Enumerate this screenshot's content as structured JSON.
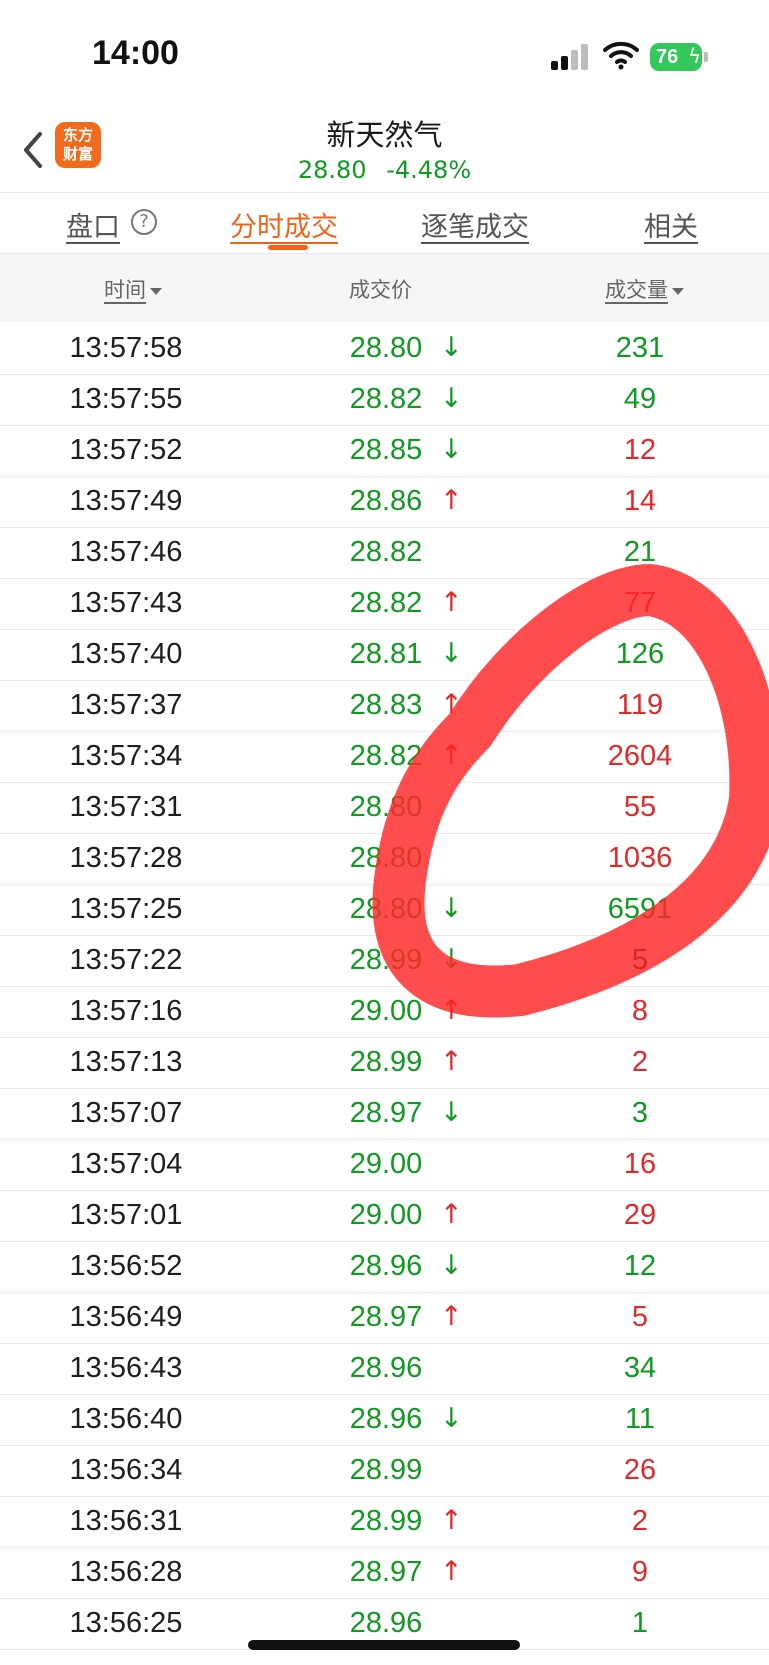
{
  "status": {
    "time": "14:00",
    "battery": "76"
  },
  "header": {
    "logo": "东方财富",
    "name": "新天然气",
    "price": "28.80",
    "change": "-4.48%"
  },
  "tabs": [
    {
      "label": "盘口"
    },
    {
      "label": "分时成交"
    },
    {
      "label": "逐笔成交"
    },
    {
      "label": "相关"
    }
  ],
  "columns": {
    "time": "时间",
    "price": "成交价",
    "volume": "成交量"
  },
  "colors": {
    "up": "#e02a2a",
    "down": "#119a22",
    "accent": "#f0631a"
  },
  "trades": [
    {
      "time": "13:57:58",
      "price": "28.80",
      "dir": "down",
      "arrow": "↓",
      "volume": "231",
      "vcolor": "g"
    },
    {
      "time": "13:57:55",
      "price": "28.82",
      "dir": "down",
      "arrow": "↓",
      "volume": "49",
      "vcolor": "g"
    },
    {
      "time": "13:57:52",
      "price": "28.85",
      "dir": "down",
      "arrow": "↓",
      "volume": "12",
      "vcolor": "r"
    },
    {
      "time": "13:57:49",
      "price": "28.86",
      "dir": "up",
      "arrow": "↑",
      "volume": "14",
      "vcolor": "r"
    },
    {
      "time": "13:57:46",
      "price": "28.82",
      "dir": "none",
      "arrow": "",
      "volume": "21",
      "vcolor": "g"
    },
    {
      "time": "13:57:43",
      "price": "28.82",
      "dir": "up",
      "arrow": "↑",
      "volume": "77",
      "vcolor": "r"
    },
    {
      "time": "13:57:40",
      "price": "28.81",
      "dir": "down",
      "arrow": "↓",
      "volume": "126",
      "vcolor": "g"
    },
    {
      "time": "13:57:37",
      "price": "28.83",
      "dir": "up",
      "arrow": "↑",
      "volume": "119",
      "vcolor": "r"
    },
    {
      "time": "13:57:34",
      "price": "28.82",
      "dir": "up",
      "arrow": "↑",
      "volume": "2604",
      "vcolor": "r"
    },
    {
      "time": "13:57:31",
      "price": "28.80",
      "dir": "none",
      "arrow": "",
      "volume": "55",
      "vcolor": "r"
    },
    {
      "time": "13:57:28",
      "price": "28.80",
      "dir": "none",
      "arrow": "",
      "volume": "1036",
      "vcolor": "r"
    },
    {
      "time": "13:57:25",
      "price": "28.80",
      "dir": "down",
      "arrow": "↓",
      "volume": "6591",
      "vcolor": "g"
    },
    {
      "time": "13:57:22",
      "price": "28.99",
      "dir": "down",
      "arrow": "↓",
      "volume": "5",
      "vcolor": "k"
    },
    {
      "time": "13:57:16",
      "price": "29.00",
      "dir": "up",
      "arrow": "↑",
      "volume": "8",
      "vcolor": "r"
    },
    {
      "time": "13:57:13",
      "price": "28.99",
      "dir": "up",
      "arrow": "↑",
      "volume": "2",
      "vcolor": "r"
    },
    {
      "time": "13:57:07",
      "price": "28.97",
      "dir": "down",
      "arrow": "↓",
      "volume": "3",
      "vcolor": "g"
    },
    {
      "time": "13:57:04",
      "price": "29.00",
      "dir": "none",
      "arrow": "",
      "volume": "16",
      "vcolor": "r"
    },
    {
      "time": "13:57:01",
      "price": "29.00",
      "dir": "up",
      "arrow": "↑",
      "volume": "29",
      "vcolor": "r"
    },
    {
      "time": "13:56:52",
      "price": "28.96",
      "dir": "down",
      "arrow": "↓",
      "volume": "12",
      "vcolor": "g"
    },
    {
      "time": "13:56:49",
      "price": "28.97",
      "dir": "up",
      "arrow": "↑",
      "volume": "5",
      "vcolor": "r"
    },
    {
      "time": "13:56:43",
      "price": "28.96",
      "dir": "none",
      "arrow": "",
      "volume": "34",
      "vcolor": "g"
    },
    {
      "time": "13:56:40",
      "price": "28.96",
      "dir": "down",
      "arrow": "↓",
      "volume": "11",
      "vcolor": "g"
    },
    {
      "time": "13:56:34",
      "price": "28.99",
      "dir": "none",
      "arrow": "",
      "volume": "26",
      "vcolor": "r"
    },
    {
      "time": "13:56:31",
      "price": "28.99",
      "dir": "up",
      "arrow": "↑",
      "volume": "2",
      "vcolor": "r"
    },
    {
      "time": "13:56:28",
      "price": "28.97",
      "dir": "up",
      "arrow": "↑",
      "volume": "9",
      "vcolor": "r"
    },
    {
      "time": "13:56:25",
      "price": "28.96",
      "dir": "none",
      "arrow": "",
      "volume": "1",
      "vcolor": "g"
    }
  ],
  "annotation": {
    "type": "hand-drawn-circle",
    "color": "#ff2a2a"
  }
}
